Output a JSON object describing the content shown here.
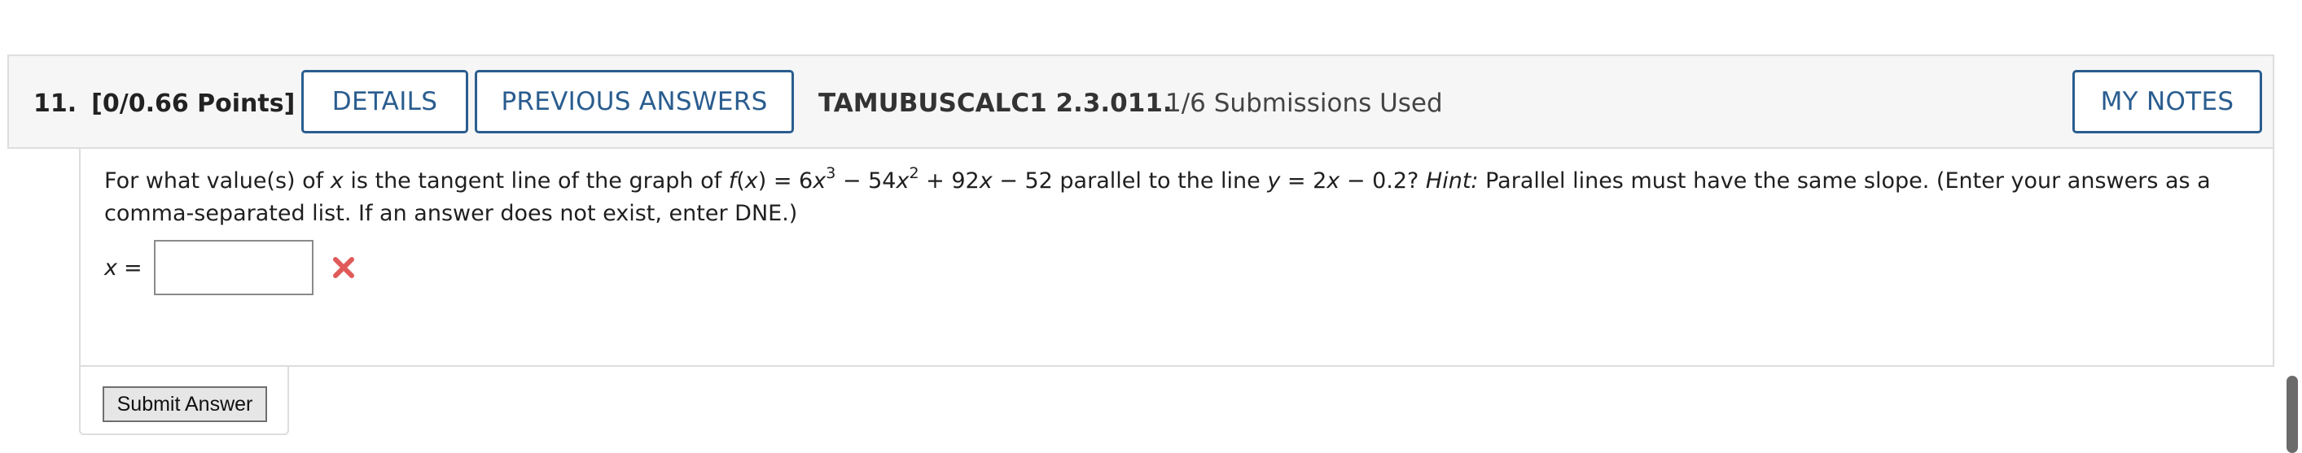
{
  "question": {
    "number": "11.",
    "points": "[0/0.66 Points]",
    "details_label": "DETAILS",
    "previous_answers_label": "PREVIOUS ANSWERS",
    "course_id": "TAMUBUSCALC1 2.3.011.",
    "submissions": "1/6 Submissions Used",
    "my_notes_label": "MY NOTES"
  },
  "body": {
    "t1": "For what value(s) of ",
    "t2": "x",
    "t3": " is the tangent line of the graph of ",
    "t4": "f",
    "t5": "(",
    "t6": "x",
    "t7": ") = 6",
    "t8": "x",
    "t9": "3",
    "t10": " − 54",
    "t11": "x",
    "t12": "2",
    "t13": " + 92",
    "t14": "x",
    "t15": " − 52 parallel to the line ",
    "t16": "y",
    "t17": " = 2",
    "t18": "x",
    "t19": " − 0.2? ",
    "t20": "Hint:",
    "t21": " Parallel lines must have the same slope. (Enter your answers as a comma-separated list. If an answer does not exist, enter DNE.)"
  },
  "answer": {
    "label_var": "x",
    "label_eq": "=",
    "value": "",
    "status_icon": "x-mark-icon",
    "status_color": "#e05a5a"
  },
  "submit": {
    "label": "Submit Answer"
  },
  "colors": {
    "accent": "#2a5d8f",
    "header_bg": "#f6f6f6"
  }
}
